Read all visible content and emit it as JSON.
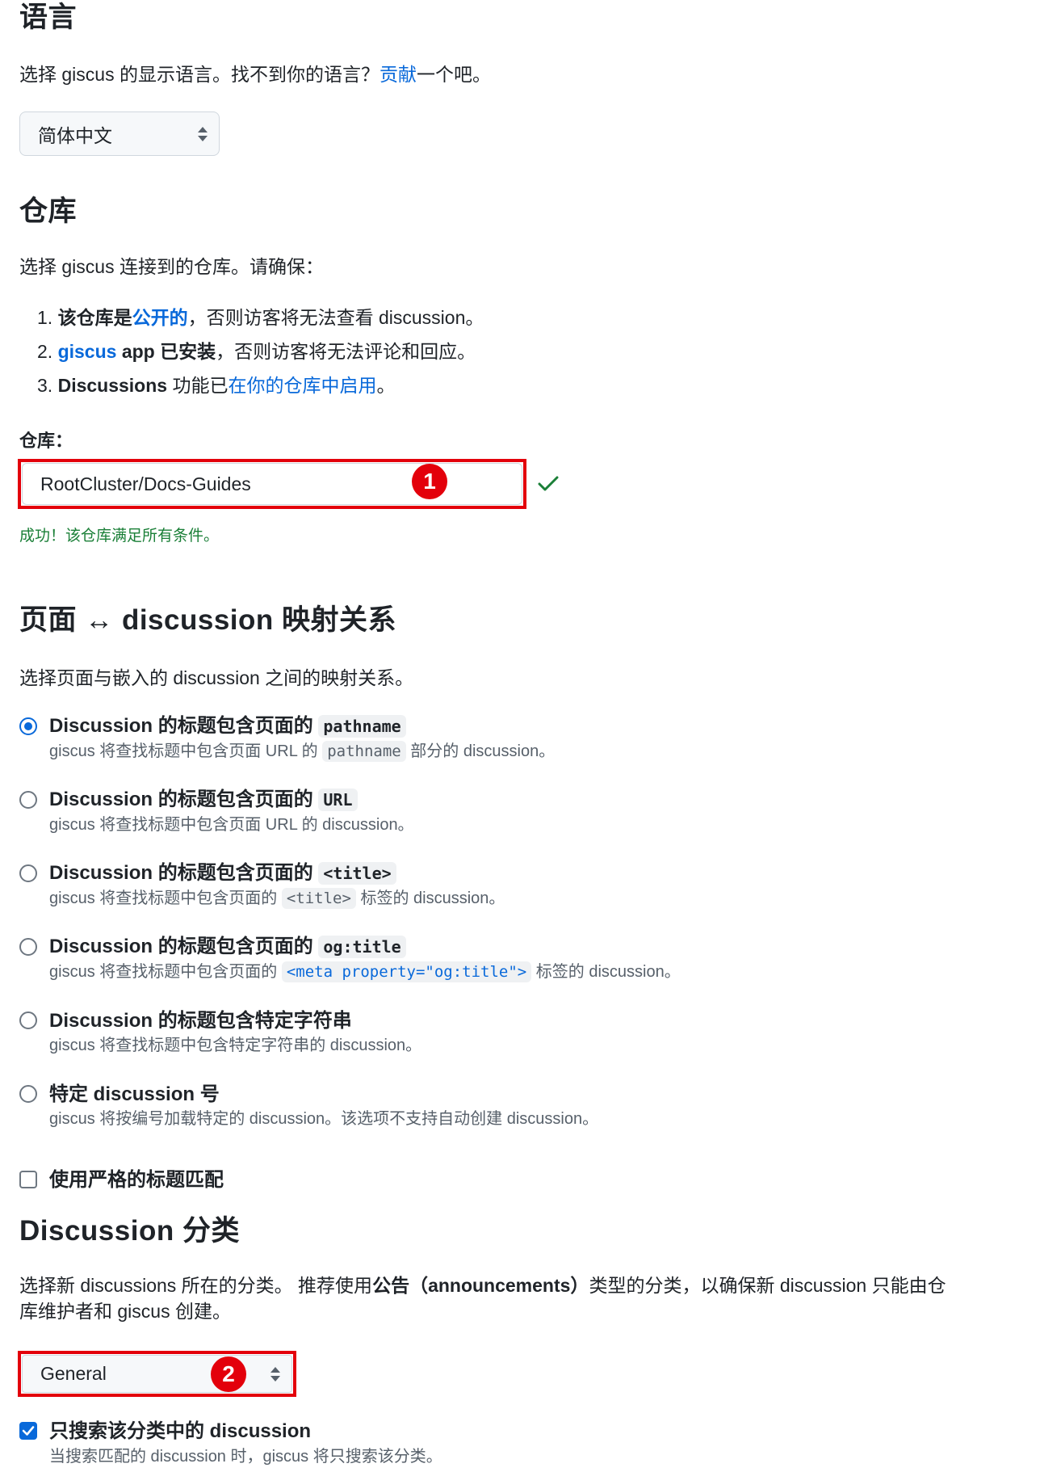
{
  "language": {
    "heading": "语言",
    "desc_prefix": "选择 giscus 的显示语言。找不到你的语言？",
    "desc_link": "贡献",
    "desc_suffix": "一个吧。",
    "selected": "简体中文"
  },
  "repository": {
    "heading": "仓库",
    "desc": "选择 giscus 连接到的仓库。请确保：",
    "req1": {
      "prefix": "该仓库是",
      "link": "公开的",
      "suffix": "，否则访客将无法查看 discussion。"
    },
    "req2": {
      "link": "giscus",
      "bold": " app 已安装",
      "suffix": "，否则访客将无法评论和回应。"
    },
    "req3": {
      "bold": "Discussions",
      "mid": " 功能已",
      "link": "在你的仓库中启用",
      "suffix": "。"
    },
    "field_label": "仓库：",
    "field_value": "RootCluster/Docs-Guides",
    "badge": "1",
    "success": "成功！该仓库满足所有条件。"
  },
  "mapping": {
    "heading": "页面 ↔ discussion 映射关系",
    "desc": "选择页面与嵌入的 discussion 之间的映射关系。",
    "options": [
      {
        "title": "Discussion 的标题包含页面的",
        "code": "pathname",
        "desc_prefix": "giscus 将查找标题中包含页面 URL 的",
        "desc_code": "pathname",
        "desc_suffix": "部分的 discussion。",
        "checked": true
      },
      {
        "title": "Discussion 的标题包含页面的",
        "code": "URL",
        "desc": "giscus 将查找标题中包含页面 URL 的 discussion。",
        "checked": false
      },
      {
        "title": "Discussion 的标题包含页面的",
        "code": "<title>",
        "desc_prefix": "giscus 将查找标题中包含页面的",
        "desc_code": "<title>",
        "desc_suffix": "标签的 discussion。",
        "checked": false
      },
      {
        "title": "Discussion 的标题包含页面的",
        "code": "og:title",
        "desc_prefix": "giscus 将查找标题中包含页面的",
        "desc_code": "<meta property=\"og:title\">",
        "desc_suffix": "标签的 discussion。",
        "checked": false
      },
      {
        "title": "Discussion 的标题包含特定字符串",
        "desc": "giscus 将查找标题中包含特定字符串的 discussion。",
        "checked": false
      },
      {
        "title": "特定 discussion 号",
        "desc": "giscus 将按编号加载特定的 discussion。该选项不支持自动创建 discussion。",
        "checked": false
      }
    ],
    "strict_label": "使用严格的标题匹配",
    "strict_checked": false
  },
  "category": {
    "heading": "Discussion 分类",
    "desc_line1_prefix": "选择新 discussions 所在的分类。 推荐使用",
    "desc_line1_bold": "公告（announcements）",
    "desc_line1_suffix": "类型的分类，以确保新 discussion 只能由仓",
    "desc_line2": "库维护者和 giscus 创建。",
    "selected": "General",
    "badge": "2",
    "only_search_label": "只搜索该分类中的 discussion",
    "only_search_desc": "当搜索匹配的 discussion 时，giscus 将只搜索该分类。",
    "only_search_checked": true
  }
}
